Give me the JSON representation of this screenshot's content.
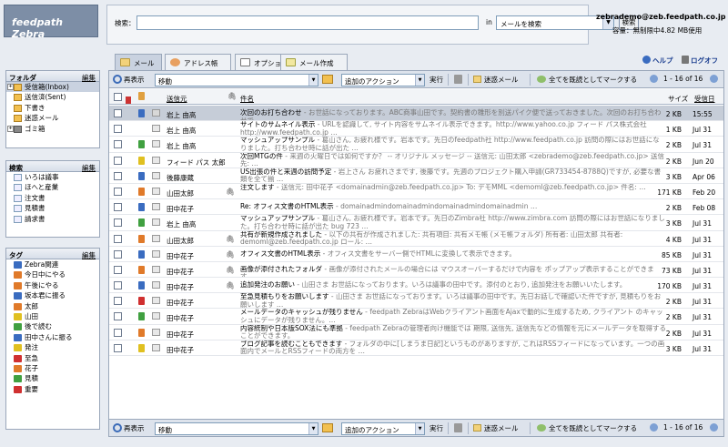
{
  "header": {
    "logo": "feedpath Zebra",
    "search_label": "検索：",
    "search_value": "",
    "in_label": "in",
    "search_scope": "メールを検索",
    "search_button": "検索",
    "user": "zebrademo@zeb.feedpath.co.jp",
    "quota": "容量：無制限中4.82 MB使用"
  },
  "tabs": [
    {
      "label": "メール"
    },
    {
      "label": "アドレス帳"
    },
    {
      "label": "オプション"
    },
    {
      "label": "メール作成"
    }
  ],
  "help_label": "ヘルプ",
  "logout_label": "ログオフ",
  "sidebar": {
    "edit": "編集",
    "folders_title": "フォルダ",
    "folders": [
      {
        "label": "受信箱(Inbox)"
      },
      {
        "label": "送信済(Sent)"
      },
      {
        "label": "下書き"
      },
      {
        "label": "迷惑メール"
      },
      {
        "label": "ゴミ箱"
      }
    ],
    "searches_title": "検索",
    "searches": [
      {
        "label": "いろは議事"
      },
      {
        "label": "ほへと産業"
      },
      {
        "label": "注文書"
      },
      {
        "label": "見積書"
      },
      {
        "label": "請求書"
      }
    ],
    "tags_title": "タグ",
    "tags": [
      {
        "label": "Zebra関連",
        "color": "#3a6cc0"
      },
      {
        "label": "今日中にやる",
        "color": "#e07a2a"
      },
      {
        "label": "午後にやる",
        "color": "#e07a2a"
      },
      {
        "label": "坂本君に振る",
        "color": "#3a6cc0"
      },
      {
        "label": "太郎",
        "color": "#e07a2a"
      },
      {
        "label": "山田",
        "color": "#e0c020"
      },
      {
        "label": "後で読む",
        "color": "#40a040"
      },
      {
        "label": "田中さんに振る",
        "color": "#3a6cc0"
      },
      {
        "label": "発注",
        "color": "#e0c020"
      },
      {
        "label": "至急",
        "color": "#d03030"
      },
      {
        "label": "花子",
        "color": "#e07a2a"
      },
      {
        "label": "見積",
        "color": "#40a040"
      },
      {
        "label": "重要",
        "color": "#d03030"
      }
    ]
  },
  "toolbar": {
    "refresh": "再表示",
    "move": "移動",
    "actions": "追加のアクション",
    "execute": "実行",
    "spam": "迷惑メール",
    "mark_all_read": "全てを既読としてマークする",
    "page_info_top": "1 - 16 of 16",
    "page_info_bottom": "1 - 16 of 16"
  },
  "columns": {
    "from": "送信元",
    "subject": "件名",
    "size": "サイズ",
    "date": "受信日"
  },
  "emails": [
    {
      "from": "岩上 由高",
      "subject": "次回のお打ち合わせ",
      "fragment": " - お世話になっております。ABC商事山田です。契約書の雛形を別送パイク便で送っておきました。次回のお打ち合わせで…",
      "size": "2 KB",
      "date": "15:55",
      "selected": true,
      "tag": "#3a6cc0",
      "read": false
    },
    {
      "from": "岩上 由高",
      "subject": "サイトのサムネイル表示",
      "fragment": " - URLを認識して, サイト内容をサムネイル表示できます。http://www.yahoo.co.jp フィード パス株式会社 http://www.feedpath.co.jp …",
      "size": "1 KB",
      "date": "Jul 31",
      "selected": false,
      "tag": "",
      "read": true
    },
    {
      "from": "岩上 由高",
      "subject": "マッシュアップサンプル",
      "fragment": " - 葛山さん, お疲れ様です。岩本です。先日のfeedpath社 http://www.feedpath.co.jp 訪問の際にはお世話になりました。打ち合わせ時に話が出た …",
      "size": "2 KB",
      "date": "Jul 31",
      "selected": false,
      "tag": "#40a040",
      "read": true
    },
    {
      "from": "フィード パス 太郎",
      "subject": "次回MTGの件",
      "fragment": " - 来週の火曜日では如何ですか？ -- オリジナル メッセージ -- 送信元: 山田太郎 <zebrademo@zeb.feedpath.co.jp> 送信先: …",
      "size": "2 KB",
      "date": "Jun 20",
      "selected": false,
      "tag": "#e0c020",
      "read": true
    },
    {
      "from": "後藤康蔵",
      "subject": "US出張の件と来週の訪問予定",
      "fragment": " - 岩上さん お疲れさまです, 後藤です。先週のプロジェクト購入申請(GR733454-8788Q)ですが, 必要な書類を全て揃 …",
      "size": "3 KB",
      "date": "Apr 06",
      "selected": false,
      "tag": "#3a6cc0",
      "read": true
    },
    {
      "from": "山田太郎",
      "subject": "注文します",
      "fragment": " - 送信元: 田中花子 <domainadmin@zeb.feedpath.co.jp> To: デモMML <demoml@zeb.feedpath.co.jp> 件名: …",
      "size": "171 KB",
      "date": "Feb 20",
      "selected": false,
      "tag": "#e07a2a",
      "read": true,
      "attach": true
    },
    {
      "from": "田中花子",
      "subject": "Re: オフィス文書のHTML表示",
      "fragment": " - domainadmindomainadmindomainadmindomainadmin …",
      "size": "2 KB",
      "date": "Feb 08",
      "selected": false,
      "tag": "#3a6cc0",
      "read": true
    },
    {
      "from": "岩上 由高",
      "subject": "マッシュアップサンプル",
      "fragment": " - 葛山さん, お疲れ様です。岩本です。先日のZimbra社 http://www.zimbra.com 訪問の際にはお世話になりました。打ち合わせ時に話が出た bug 723 …",
      "size": "3 KB",
      "date": "Jul 31",
      "selected": false,
      "tag": "#40a040",
      "read": true
    },
    {
      "from": "山田太郎",
      "subject": "共有が新規作成されました",
      "fragment": " - 以下の共有が作成されました: 共有項目: 共有メモ帳 (メモ帳フォルダ) 所有者: 山田太郎 共有者: demoml@zeb.feedpath.co.jp ロール: …",
      "size": "4 KB",
      "date": "Jul 31",
      "selected": false,
      "tag": "#e07a2a",
      "read": true,
      "attach": true
    },
    {
      "from": "田中花子",
      "subject": "オフィス文書のHTML表示",
      "fragment": " - オフィス文書をサーバー側でHTMLに変換して表示できます。",
      "size": "85 KB",
      "date": "Jul 31",
      "selected": false,
      "tag": "#3a6cc0",
      "read": true,
      "attach": true
    },
    {
      "from": "田中花子",
      "subject": "画像が添付されたフォルダ",
      "fragment": " - 画像が添付されたメールの場合には マウスオーバーするだけで内容を ポップアップ表示することができます。",
      "size": "73 KB",
      "date": "Jul 31",
      "selected": false,
      "tag": "#e07a2a",
      "read": true,
      "attach": true
    },
    {
      "from": "田中花子",
      "subject": "追加発注のお願い",
      "fragment": " - 山田さま お世話になっております。いろは議事の田中です。添付のとおり, 追加発注をお願いいたします。",
      "size": "170 KB",
      "date": "Jul 31",
      "selected": false,
      "tag": "#3a6cc0",
      "read": true,
      "attach": true
    },
    {
      "from": "田中花子",
      "subject": "至急見積もりをお願いします",
      "fragment": " - 山田さま お世話になっております。いろは議事の田中です。先日お話しで確認いた件ですが, 見積もりをお願いします …",
      "size": "2 KB",
      "date": "Jul 31",
      "selected": false,
      "tag": "#d03030",
      "read": true
    },
    {
      "from": "田中花子",
      "subject": "メールデータのキャッシュが残りません",
      "fragment": " - feedpath ZebraはWebクライアント画面をAjaxで動的に生成するため, クライアント のキャッシュにデータが残りません。…",
      "size": "2 KB",
      "date": "Jul 31",
      "selected": false,
      "tag": "#40a040",
      "read": true
    },
    {
      "from": "田中花子",
      "subject": "内容統制や日本版SOX法にも準拠",
      "fragment": " - feedpath Zebraの管理者向け機能では 期限, 送信先, 送信先などの情報を元にメールデータを取得することができます。",
      "size": "2 KB",
      "date": "Jul 31",
      "selected": false,
      "tag": "#e07a2a",
      "read": true
    },
    {
      "from": "田中花子",
      "subject": "ブログ記事を読むこともできます",
      "fragment": " - フォルダの中に[しまうま日記]というものがありますが, これはRSSフィードになっています。一つの画面内でメールとRSSフィードの両方を …",
      "size": "3 KB",
      "date": "Jul 31",
      "selected": false,
      "tag": "#e0c020",
      "read": true
    }
  ]
}
